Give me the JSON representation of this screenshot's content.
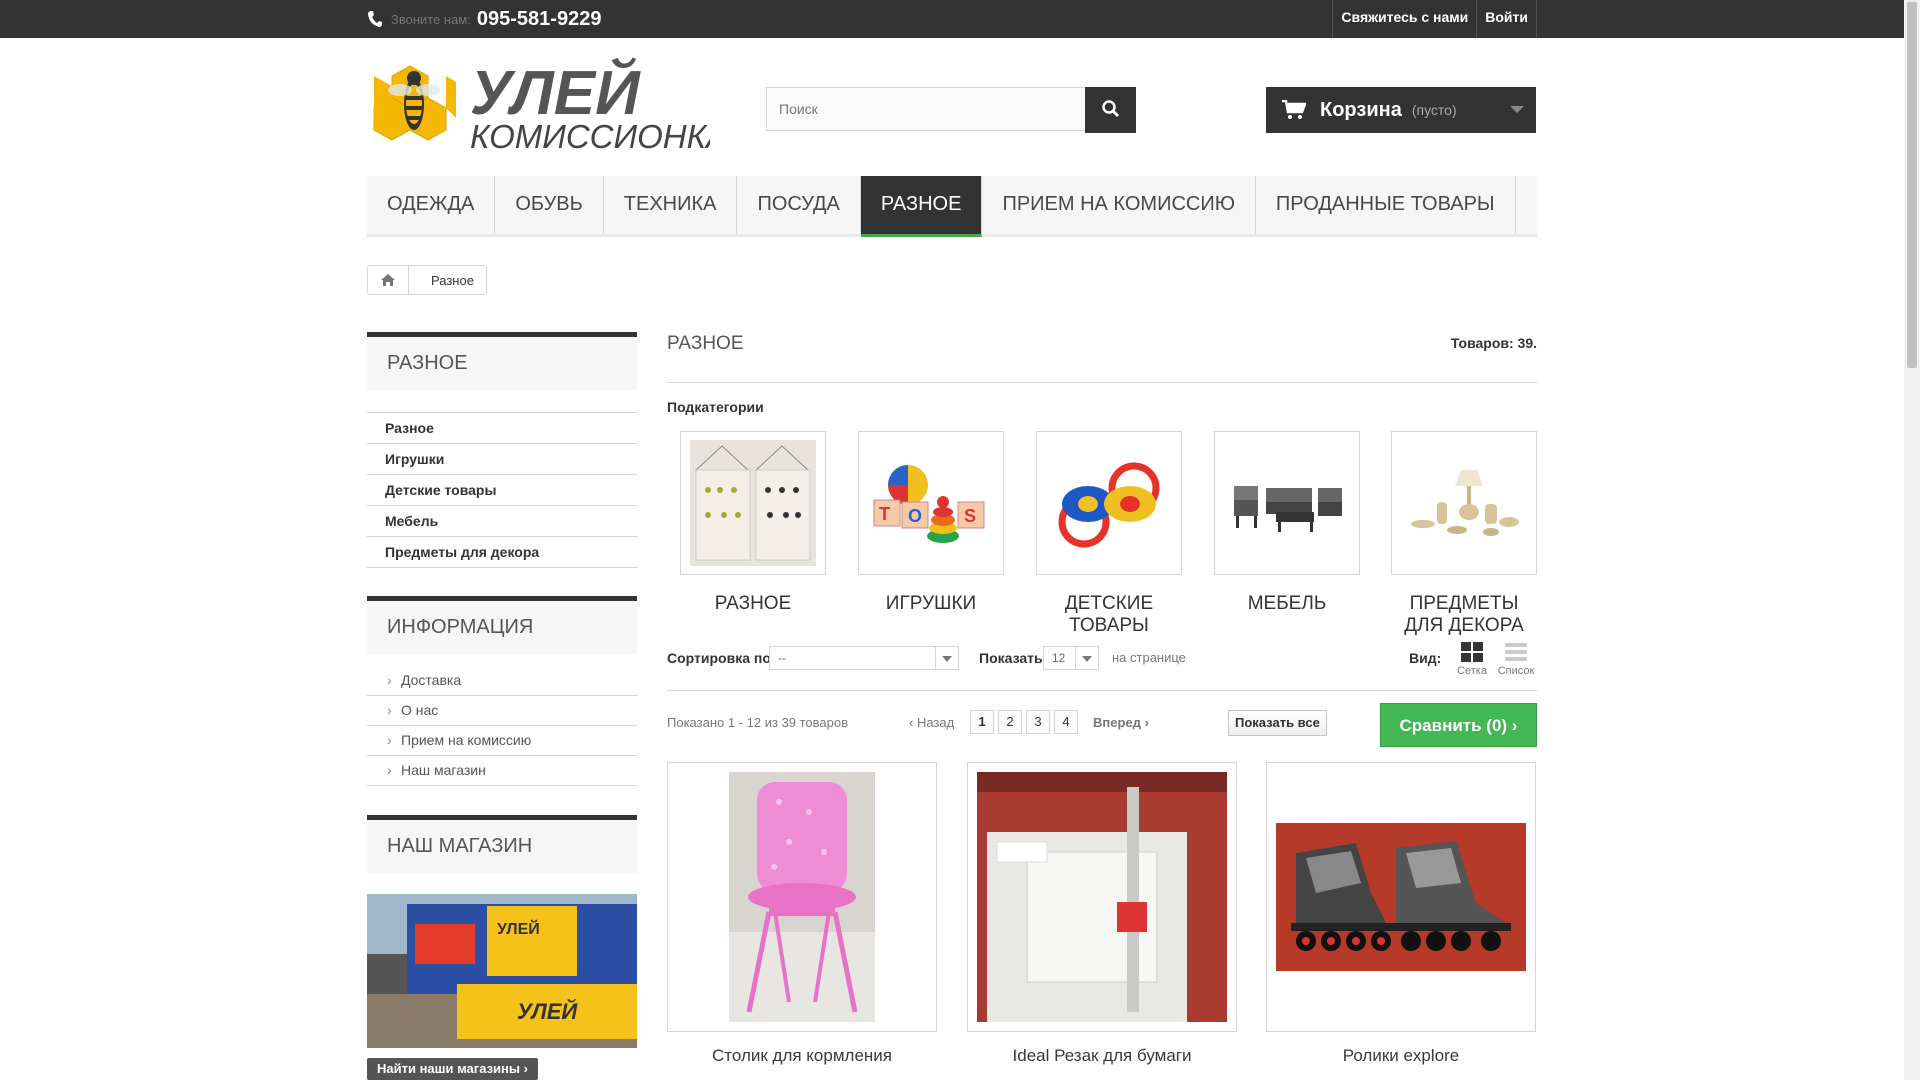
{
  "topbar": {
    "call_label": "Звоните нам:",
    "phone": "095-581-9229",
    "contact_link": "Свяжитесь с нами",
    "login_link": "Войти"
  },
  "logo": {
    "line1": "УЛЕЙ",
    "line2": "КОМИССИОНКА"
  },
  "search": {
    "placeholder": "Поиск"
  },
  "cart": {
    "label": "Корзина",
    "status": "(пусто)"
  },
  "menu": {
    "items": [
      {
        "label": "ОДЕЖДА",
        "active": false
      },
      {
        "label": "ОБУВЬ",
        "active": false
      },
      {
        "label": "ТЕХНИКА",
        "active": false
      },
      {
        "label": "ПОСУДА",
        "active": false
      },
      {
        "label": "РАЗНОЕ",
        "active": true
      },
      {
        "label": "ПРИЕМ НА КОМИССИЮ",
        "active": false
      },
      {
        "label": "ПРОДАННЫЕ ТОВАРЫ",
        "active": false
      }
    ]
  },
  "breadcrumb": {
    "current": "Разное"
  },
  "sidebar": {
    "categories": {
      "title": "РАЗНОЕ",
      "items": [
        "Разное",
        "Игрушки",
        "Детские товары",
        "Мебель",
        "Предметы для декора"
      ]
    },
    "info": {
      "title": "ИНФОРМАЦИЯ",
      "items": [
        "Доставка",
        "О нас",
        "Прием на комиссию",
        "Наш магазин"
      ]
    },
    "store": {
      "title": "НАШ МАГАЗИН",
      "find_button": "Найти наши магазины"
    }
  },
  "main": {
    "title": "РАЗНОЕ",
    "count": "Товаров: 39.",
    "subcategories_label": "Подкатегории",
    "subcategories": [
      {
        "name": "РАЗНОЕ",
        "icon": "wall-organizer-image"
      },
      {
        "name": "ИГРУШКИ",
        "icon": "toys-image"
      },
      {
        "name": "ДЕТСКИЕ ТОВАРЫ",
        "icon": "pacifiers-image"
      },
      {
        "name": "МЕБЕЛЬ",
        "icon": "garden-furniture-image"
      },
      {
        "name": "ПРЕДМЕТЫ ДЛЯ ДЕКОРА",
        "icon": "decor-items-image"
      }
    ],
    "sort": {
      "label": "Сортировка по",
      "value": "--",
      "show_label": "Показать",
      "per_page_value": "12",
      "per_page_suffix": "на странице",
      "view_label": "Вид:",
      "view_grid": "Сетка",
      "view_list": "Список"
    },
    "pagination": {
      "shown": "Показано 1 - 12 из 39 товаров",
      "prev": "Назад",
      "pages": [
        "1",
        "2",
        "3",
        "4"
      ],
      "current_page": "1",
      "next": "Вперед",
      "show_all": "Показать все",
      "compare": "Сравнить (0)"
    },
    "products": [
      {
        "name": "Столик для кормления",
        "icon": "pink-highchair-image"
      },
      {
        "name": "Ideal Резак для бумаги",
        "icon": "paper-cutter-image"
      },
      {
        "name": "Ролики explore",
        "icon": "inline-skates-image"
      }
    ]
  },
  "colors": {
    "topbar_bg": "#333333",
    "accent_green": "#43b754",
    "menu_active_bg": "#333333",
    "logo_honey": "#f5b800"
  }
}
